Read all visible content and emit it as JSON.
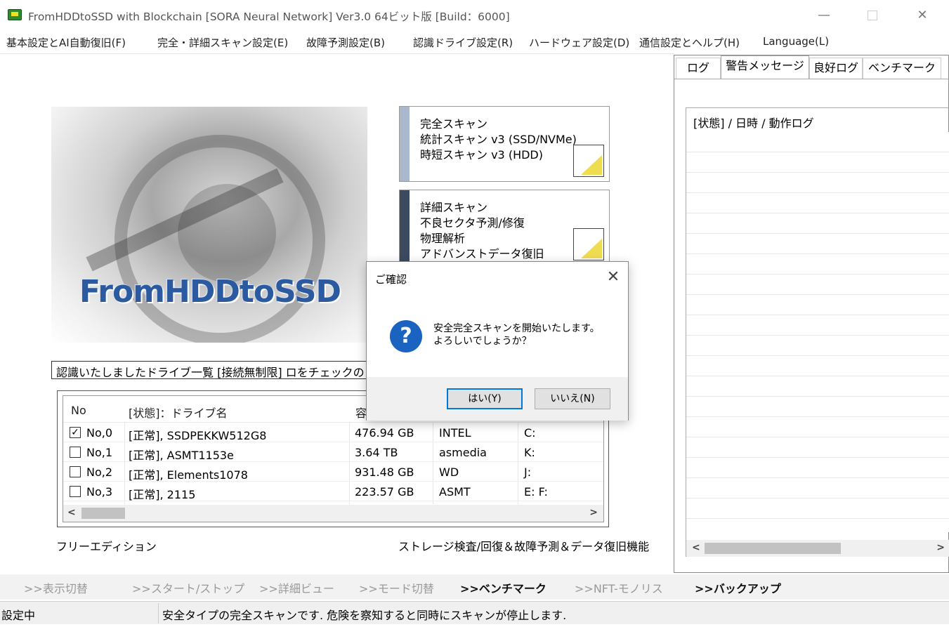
{
  "window": {
    "title": "FromHDDtoSSD with Blockchain [SORA Neural Network] Ver3.0 64ビット版 [Build：6000]",
    "minimize_glyph": "—",
    "close_glyph": "✕"
  },
  "menu": [
    "基本設定とAI自動復旧(F)",
    "完全・詳細スキャン設定(E)",
    "故障予測設定(B)",
    "認識ドライブ設定(R)",
    "ハードウェア設定(D)",
    "通信設定とヘルプ(H)",
    "Language(L)"
  ],
  "logo": {
    "text": "FromHDDtoSSD"
  },
  "scan_full": {
    "line1": "完全スキャン",
    "line2": "統計スキャン v3 (SSD/NVMe)",
    "line3": "時短スキャン v3 (HDD)"
  },
  "scan_detail": {
    "line1": "詳細スキャン",
    "line2": "不良セクタ予測/修復",
    "line3": "物理解析",
    "line4": "アドバンストデータ復旧"
  },
  "drive_list": {
    "label": "認識いたしましたドライブ一覧 [接続無制限] ロをチェックの",
    "columns": [
      "No",
      "[状態]：ドライブ名",
      "容"
    ],
    "rows": [
      {
        "checked": true,
        "no": "No,0",
        "name": "[正常], SSDPEKKW512G8",
        "size": "476.94 GB",
        "vendor": "INTEL",
        "letters": "C:"
      },
      {
        "checked": false,
        "no": "No,1",
        "name": "[正常], ASMT1153e",
        "size": "3.64 TB",
        "vendor": "asmedia",
        "letters": "K:"
      },
      {
        "checked": false,
        "no": "No,2",
        "name": "[正常], Elements1078",
        "size": "931.48 GB",
        "vendor": "WD",
        "letters": "J:"
      },
      {
        "checked": false,
        "no": "No,3",
        "name": "[正常], 2115",
        "size": "223.57 GB",
        "vendor": "ASMT",
        "letters": "E: F:"
      }
    ],
    "scroll_left": "<",
    "scroll_right": ">"
  },
  "edition": {
    "left": "フリーエディション",
    "right": "ストレージ検査/回復＆故障予測＆データ復旧機能"
  },
  "tabs": [
    {
      "label": "ログ",
      "active": false
    },
    {
      "label": "警告メッセージ",
      "active": true
    },
    {
      "label": "良好ログ",
      "active": false
    },
    {
      "label": "ベンチマーク",
      "active": false
    }
  ],
  "log": {
    "header": "[状態] / 日時 / 動作ログ",
    "scroll_left": "<",
    "scroll_right": ">"
  },
  "commands": [
    {
      "label": ">>表示切替",
      "strong": false
    },
    {
      "label": ">>スタート/ストップ",
      "strong": false
    },
    {
      "label": ">>詳細ビュー",
      "strong": false
    },
    {
      "label": ">>モード切替",
      "strong": false
    },
    {
      "label": ">>ベンチマーク",
      "strong": true
    },
    {
      "label": ">>NFT-モノリス",
      "strong": false
    },
    {
      "label": ">>バックアップ",
      "strong": true
    }
  ],
  "status": {
    "left": "設定中",
    "right": "安全タイプの完全スキャンです. 危険を察知すると同時にスキャンが停止します."
  },
  "dialog": {
    "title": "ご確認",
    "close_glyph": "✕",
    "icon_glyph": "?",
    "message_line1": "安全完全スキャンを開始いたします。",
    "message_line2": "よろしいでしょうか？",
    "yes": "はい(Y)",
    "no": "いいえ(N)"
  },
  "colors": {
    "accent": "#0078d7",
    "logo_text": "#2c5aa0",
    "question_icon": "#1a63c0",
    "full_scan_bar": "#a9b8cc",
    "detail_scan_bar": "#3c4a60"
  }
}
